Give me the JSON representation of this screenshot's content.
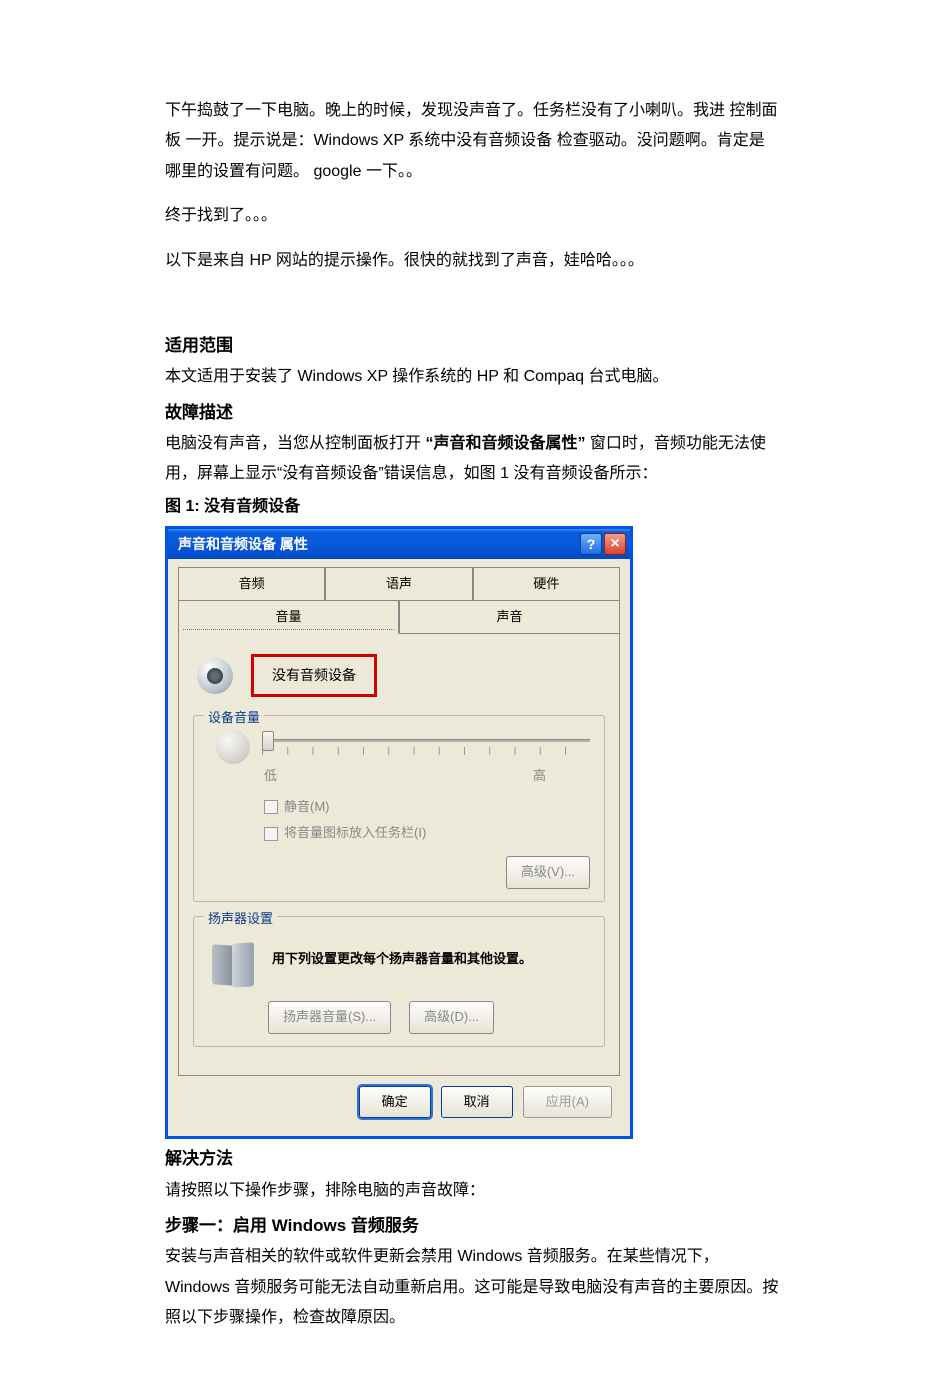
{
  "paragraphs": {
    "p1": "下午捣鼓了一下电脑。晚上的时候，发现没声音了。任务栏没有了小喇叭。我进 控制面板 一开。提示说是：Windows XP 系统中没有音频设备   检查驱动。没问题啊。肯定是哪里的设置有问题。   google 一下。。",
    "p2": "终于找到了。。。",
    "p3": "以下是来自 HP  网站的提示操作。很快的就找到了声音，娃哈哈。。。"
  },
  "sections": {
    "scope_h": "适用范围",
    "scope_t": "本文适用于安装了 Windows XP 操作系统的 HP 和 Compaq 台式电脑。",
    "fault_h": "故障描述",
    "fault_t1a": "电脑没有声音，当您从控制面板打开 ",
    "fault_t1b": "“声音和音频设备属性”",
    "fault_t1c": " 窗口时，音频功能无法使用，屏幕上显示“没有音频设备”错误信息，如图 1 没有音频设备所示：",
    "fig1": "图 1: 没有音频设备",
    "solution_h": "解决方法",
    "solution_t": "请按照以下操作步骤，排除电脑的声音故障：",
    "step1_h": "步骤一：启用 Windows 音频服务",
    "step1_t": "安装与声音相关的软件或软件更新会禁用 Windows 音频服务。在某些情况下，Windows 音频服务可能无法自动重新启用。这可能是导致电脑没有声音的主要原因。按照以下步骤操作，检查故障原因。"
  },
  "dialog": {
    "title": "声音和音频设备 属性",
    "tabs_back": {
      "t1": "音频",
      "t2": "语声",
      "t3": "硬件"
    },
    "tabs_front": {
      "t1": "音量",
      "t2": "声音"
    },
    "no_device": "没有音频设备",
    "group_vol": "设备音量",
    "low": "低",
    "high": "高",
    "mute": "静音(M)",
    "tray": "将音量图标放入任务栏(I)",
    "adv_v": "高级(V)...",
    "group_spk": "扬声器设置",
    "spk_text": "用下列设置更改每个扬声器音量和其他设置。",
    "spk_vol": "扬声器音量(S)...",
    "adv_d": "高级(D)...",
    "ok": "确定",
    "cancel": "取消",
    "apply": "应用(A)"
  }
}
